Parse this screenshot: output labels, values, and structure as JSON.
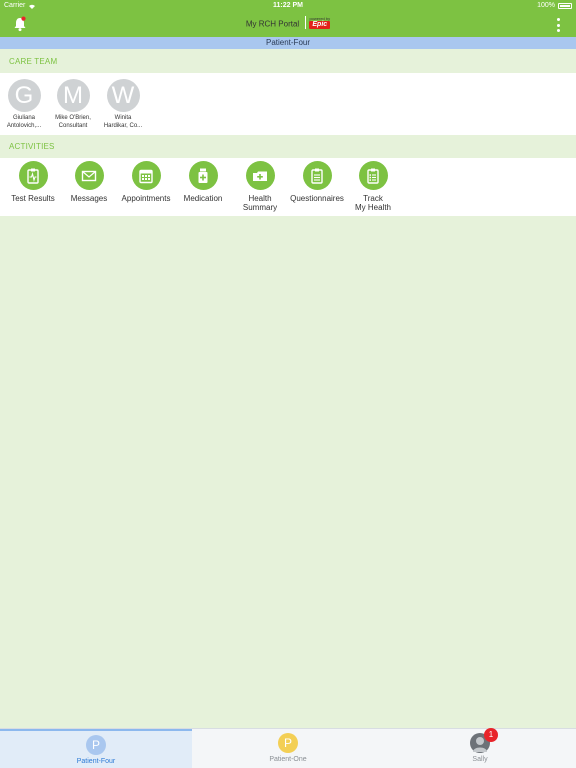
{
  "status_bar": {
    "carrier": "Carrier",
    "time": "11:22 PM",
    "battery": "100%"
  },
  "nav": {
    "title": "My RCH Portal",
    "powered_by": "powered by",
    "brand": "Epic"
  },
  "patient_banner": "Patient-Four",
  "care_team": {
    "header": "CARE TEAM",
    "members": [
      {
        "initial": "G",
        "name_line1": "Giuliana",
        "name_line2": "Antolovich,..."
      },
      {
        "initial": "M",
        "name_line1": "Mike O'Brien,",
        "name_line2": "Consultant"
      },
      {
        "initial": "W",
        "name_line1": "Winita",
        "name_line2": "Hardikar, Co..."
      }
    ]
  },
  "activities": {
    "header": "ACTIVITIES",
    "items": [
      {
        "line1": "Test Results",
        "line2": "",
        "icon": "test-results-icon"
      },
      {
        "line1": "Messages",
        "line2": "",
        "icon": "envelope-icon"
      },
      {
        "line1": "Appointments",
        "line2": "",
        "icon": "calendar-icon"
      },
      {
        "line1": "Medication",
        "line2": "",
        "icon": "pill-bottle-icon"
      },
      {
        "line1": "Health",
        "line2": "Summary",
        "icon": "medical-folder-icon"
      },
      {
        "line1": "Questionnaires",
        "line2": "",
        "icon": "clipboard-icon"
      },
      {
        "line1": "Track",
        "line2": "My Health",
        "icon": "clipboard-checklist-icon"
      }
    ]
  },
  "tabs": [
    {
      "initial": "P",
      "label": "Patient-Four",
      "color": "#a9c7ef",
      "label_color": "#2c7ad6",
      "active": true
    },
    {
      "initial": "P",
      "label": "Patient-One",
      "color": "#f3cf55",
      "label_color": "#8a8f94",
      "active": false
    },
    {
      "initial": "",
      "label": "Sally",
      "color": "#6d7278",
      "label_color": "#8a8f94",
      "active": false,
      "badge": "1"
    }
  ],
  "colors": {
    "brand_green": "#7dc242",
    "background": "#e6f2da",
    "banner_blue": "#a9c7ef",
    "badge_red": "#e8242a"
  }
}
